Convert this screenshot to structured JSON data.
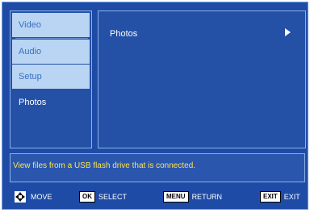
{
  "sidebar": {
    "items": [
      {
        "label": "Video",
        "state": "light"
      },
      {
        "label": "Audio",
        "state": "light"
      },
      {
        "label": "Setup",
        "state": "light"
      },
      {
        "label": "Photos",
        "state": "active"
      }
    ]
  },
  "main": {
    "title": "Photos",
    "arrow_icon": "play-arrow-icon"
  },
  "description": "View files from a USB flash drive that is connected.",
  "footer": {
    "move": {
      "label": "MOVE",
      "icon": "dpad-icon"
    },
    "select": {
      "key": "OK",
      "label": "SELECT"
    },
    "return": {
      "key": "MENU",
      "label": "RETURN"
    },
    "exit": {
      "key": "EXIT",
      "label": "EXIT"
    }
  },
  "colors": {
    "background": "#1d4ba6",
    "highlight": "#b9d5f3",
    "description_text": "#ffe34d"
  }
}
